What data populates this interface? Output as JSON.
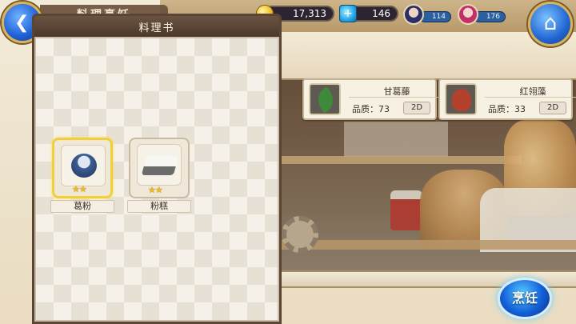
{
  "header": {
    "screen_title": "料理烹饪",
    "gold": "17,313",
    "gems": "146",
    "gem_icon_glyph": "+",
    "party": [
      {
        "stamina": "114"
      },
      {
        "stamina": "176"
      }
    ],
    "home_glyph": "⌂",
    "back_glyph": "❮"
  },
  "recipe_book": {
    "title": "料理书",
    "recipes": [
      {
        "label": "葛粉",
        "stars": "★★",
        "selected": true
      },
      {
        "label": "粉糕",
        "stars": "★★",
        "selected": false
      }
    ]
  },
  "ingredients": [
    {
      "name": "甘葛藤",
      "quality": "品质：73",
      "tag": "2D",
      "icon": "leaf-icon",
      "color": "#3f8a3a"
    },
    {
      "name": "红翎藻",
      "quality": "品质：33",
      "tag": "2D",
      "icon": "seaweed-icon",
      "color": "#b5402c"
    }
  ],
  "cook_button": {
    "label": "烹饪"
  },
  "colors": {
    "panel_brown": "#5a4434",
    "selected_border": "#f1cf3a",
    "button_blue": "#1260d8"
  }
}
